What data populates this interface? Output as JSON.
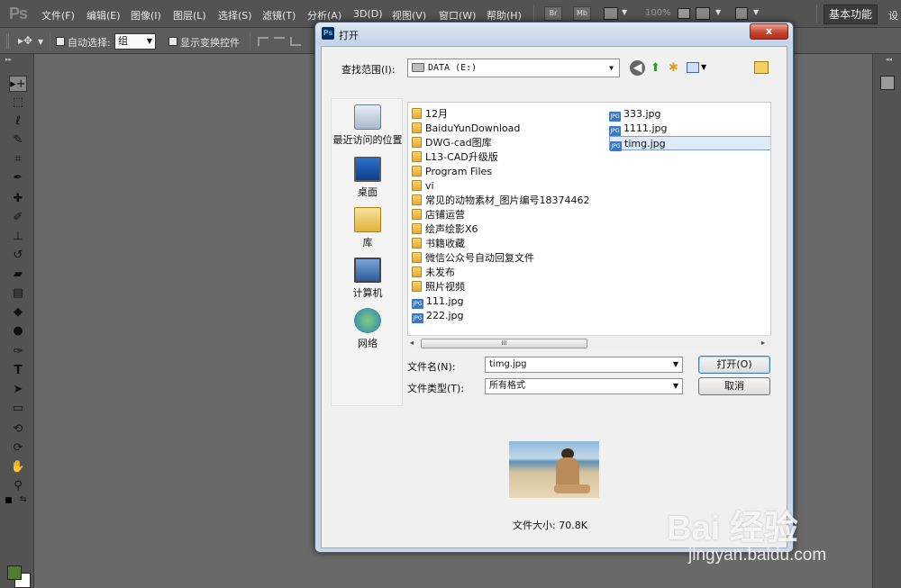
{
  "app": {
    "logo": "Ps",
    "menu": [
      "文件(F)",
      "编辑(E)",
      "图像(I)",
      "图层(L)",
      "选择(S)",
      "滤镜(T)",
      "分析(A)",
      "3D(D)",
      "视图(V)",
      "窗口(W)",
      "帮助(H)"
    ],
    "mini_buttons": [
      "Br",
      "Mb"
    ],
    "zoom": "100%",
    "workspace": "基本功能",
    "settings_label": "设"
  },
  "options_bar": {
    "auto_select_label": "自动选择:",
    "auto_select_value": "组",
    "show_transform_label": "显示变换控件"
  },
  "dialog": {
    "title": "打开",
    "close_label": "x",
    "look_in_label": "查找范围(I):",
    "look_in_value": "DATA (E:)",
    "places": [
      {
        "label": "最近访问的位置",
        "icon": "recent-places-icon"
      },
      {
        "label": "桌面",
        "icon": "desktop-icon"
      },
      {
        "label": "库",
        "icon": "libraries-icon"
      },
      {
        "label": "计算机",
        "icon": "computer-icon"
      },
      {
        "label": "网络",
        "icon": "network-icon"
      }
    ],
    "folders": [
      "12月",
      "BaiduYunDownload",
      "DWG-cad图库",
      "L13-CAD升级版",
      "Program Files",
      "vi",
      "常见的动物素材_图片编号18374462",
      "店铺运营",
      "绘声绘影X6",
      "书籍收藏",
      "微信公众号自动回复文件",
      "未发布",
      "照片视频"
    ],
    "files_col1": [
      "111.jpg",
      "222.jpg"
    ],
    "files_col2": [
      "333.jpg",
      "1111.jpg",
      "timg.jpg"
    ],
    "filename_label": "文件名(N):",
    "filename_value": "timg.jpg",
    "filetype_label": "文件类型(T):",
    "filetype_value": "所有格式",
    "open_button": "打开(O)",
    "cancel_button": "取消",
    "scroll_grip": "III",
    "file_size": "文件大小: 70.8K"
  },
  "watermark": {
    "logo": "Bai 经验",
    "url": "jingyan.baidu.com"
  },
  "colors": {
    "foreground": "#4e7b2c",
    "background": "#ffffff"
  }
}
